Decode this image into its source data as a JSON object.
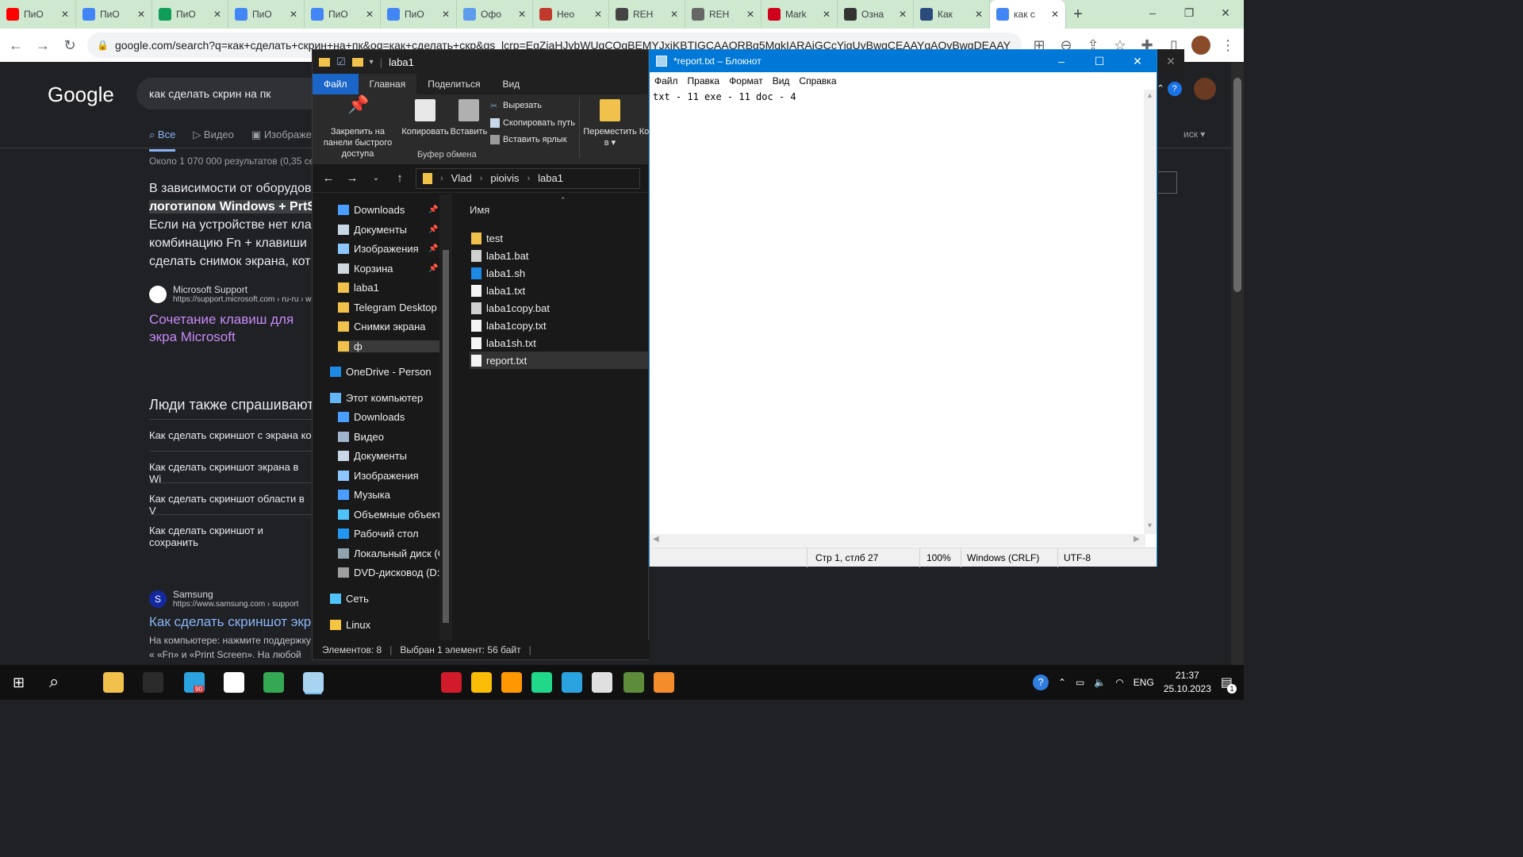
{
  "chrome": {
    "tabs": [
      {
        "label": "ПиО",
        "color": "#ff0000",
        "icon": "youtube-icon"
      },
      {
        "label": "ПиО",
        "color": "#4285f4",
        "icon": "docs-icon"
      },
      {
        "label": "ПиО",
        "color": "#0f9d58",
        "icon": "sheets-icon"
      },
      {
        "label": "ПиО",
        "color": "#4285f4",
        "icon": "docs-icon"
      },
      {
        "label": "ПиО",
        "color": "#4285f4",
        "icon": "docs-icon"
      },
      {
        "label": "ПиО",
        "color": "#4285f4",
        "icon": "docs-icon"
      },
      {
        "label": "Офо",
        "color": "#5d9cec",
        "icon": "settings-icon"
      },
      {
        "label": "Нео",
        "color": "#c0392b",
        "icon": "doc-red-icon"
      },
      {
        "label": "REH",
        "color": "#444444",
        "icon": "github-icon"
      },
      {
        "label": "REH",
        "color": "#666666",
        "icon": "github-icon"
      },
      {
        "label": "Mark",
        "color": "#d0021b",
        "icon": "vivaldi-icon"
      },
      {
        "label": "Озна",
        "color": "#333333",
        "icon": "keyboard-icon"
      },
      {
        "label": "Как",
        "color": "#2b4b7c",
        "icon": "app-icon"
      },
      {
        "label": "как с",
        "color": "#4285f4",
        "icon": "google-icon"
      }
    ],
    "new_tab": "+",
    "url": "google.com/search?q=как+сделать+скрин+на+пк&oq=как+сделать+скр&gs_lcrp=EgZjaHJvbWUqCQgBEMYJxjKBTIGCAAQRBg5MgkIARAjGCcYigUyBwgCEAAYgAQyBwgDEAAY",
    "window_controls": {
      "minimize": "–",
      "restore": "❐",
      "close": "✕"
    }
  },
  "google": {
    "logo": "Google",
    "query": "как сделать скрин на пк",
    "tabs": [
      "Все",
      "Видео",
      "Изображен"
    ],
    "active_tab": "Все",
    "tools": "иск ▾",
    "results_count": "Около 1 070 000 результатов (0,35 сек",
    "snippet_before": "В зависимости от оборудов",
    "snippet_highlight": "логотипом Windows + PrtSc",
    "snippet_after": "Если на устройстве нет кла комбинацию Fn + клавиши сделать снимок экрана, кот",
    "source1_name": "Microsoft Support",
    "source1_url": "https://support.microsoft.com › ru-ru › w",
    "link1": "Сочетание клавиш для экра Microsoft",
    "people_title": "Люди также спрашивают",
    "questions": [
      "Как сделать скриншот с экрана ко",
      "Как сделать скриншот экрана в Wi",
      "Как сделать скриншот области в V",
      "Как сделать скриншот и сохранить"
    ],
    "source2_letter": "S",
    "source2_name": "Samsung",
    "source2_url": "https://www.samsung.com › support",
    "link2": "Как сделать скриншот экра",
    "desc2": "На компьютере: нажмите поддержку « «Fn» и «Print Screen». На любой клави"
  },
  "explorer": {
    "title": "laba1",
    "ribbon_tabs": [
      "Файл",
      "Главная",
      "Поделиться",
      "Вид"
    ],
    "ribbon": {
      "pin": "Закрепить на панели быстрого доступа",
      "copy": "Копировать",
      "paste": "Вставить",
      "cut": "Вырезать",
      "copy_path": "Скопировать путь",
      "paste_shortcut": "Вставить ярлык",
      "move": "Переместить в ▾",
      "move_tail": "Ко",
      "group_label": "Буфер обмена"
    },
    "path": [
      "Vlad",
      "pioivis",
      "laba1"
    ],
    "nav_items": [
      {
        "label": "Downloads",
        "icon": "download-icon",
        "color": "#4a9eff",
        "pinned": true
      },
      {
        "label": "Документы",
        "icon": "documents-icon",
        "color": "#c8d6e5",
        "pinned": true
      },
      {
        "label": "Изображения",
        "icon": "pictures-icon",
        "color": "#8ec5ff",
        "pinned": true
      },
      {
        "label": "Корзина",
        "icon": "recycle-bin-icon",
        "color": "#cfd8dc",
        "pinned": true
      },
      {
        "label": "laba1",
        "icon": "folder-icon",
        "color": "#f0c14b",
        "pinned": false
      },
      {
        "label": "Telegram Desktop",
        "icon": "folder-icon",
        "color": "#f0c14b",
        "pinned": false
      },
      {
        "label": "Снимки экрана",
        "icon": "folder-icon",
        "color": "#f0c14b",
        "pinned": false
      },
      {
        "label": "ф",
        "icon": "folder-icon",
        "color": "#f0c14b",
        "pinned": false
      }
    ],
    "onedrive": "OneDrive - Personal",
    "thispc": "Этот компьютер",
    "pc_items": [
      {
        "label": "Downloads",
        "icon": "download-icon",
        "color": "#4a9eff"
      },
      {
        "label": "Видео",
        "icon": "video-icon",
        "color": "#a0b4d0"
      },
      {
        "label": "Документы",
        "icon": "documents-icon",
        "color": "#c8d6e5"
      },
      {
        "label": "Изображения",
        "icon": "pictures-icon",
        "color": "#8ec5ff"
      },
      {
        "label": "Музыка",
        "icon": "music-icon",
        "color": "#4a9eff"
      },
      {
        "label": "Объемные объекты",
        "icon": "3d-objects-icon",
        "color": "#4fc3f7"
      },
      {
        "label": "Рабочий стол",
        "icon": "desktop-icon",
        "color": "#2196f3"
      },
      {
        "label": "Локальный диск (C",
        "icon": "disk-icon",
        "color": "#90a4ae"
      },
      {
        "label": "DVD-дисковод (D:)",
        "icon": "dvd-icon",
        "color": "#9e9e9e"
      }
    ],
    "network": "Сеть",
    "linux": "Linux",
    "column_header": "Имя",
    "files": [
      {
        "name": "test",
        "icon": "folder-icon",
        "color": "#f0c14b"
      },
      {
        "name": "laba1.bat",
        "icon": "bat-file-icon",
        "color": "#d0d0d0"
      },
      {
        "name": "laba1.sh",
        "icon": "ie-file-icon",
        "color": "#1e88e5"
      },
      {
        "name": "laba1.txt",
        "icon": "text-file-icon",
        "color": "#f5f5f5"
      },
      {
        "name": "laba1copy.bat",
        "icon": "bat-file-icon",
        "color": "#d0d0d0"
      },
      {
        "name": "laba1copy.txt",
        "icon": "text-file-icon",
        "color": "#f5f5f5"
      },
      {
        "name": "laba1sh.txt",
        "icon": "text-file-icon",
        "color": "#f5f5f5"
      },
      {
        "name": "report.txt",
        "icon": "text-file-icon",
        "color": "#f5f5f5",
        "selected": true
      }
    ],
    "status_count": "Элементов: 8",
    "status_selected": "Выбран 1 элемент: 56 байт"
  },
  "notepad": {
    "title": "*report.txt – Блокнот",
    "menu": [
      "Файл",
      "Правка",
      "Формат",
      "Вид",
      "Справка"
    ],
    "content": "txt - 11 exe - 11 doc - 4",
    "status_pos": "Стр 1, стлб 27",
    "status_zoom": "100%",
    "status_eol": "Windows (CRLF)",
    "status_enc": "UTF-8"
  },
  "taskbar": {
    "telegram_badge": "90",
    "lang": "ENG",
    "time": "21:37",
    "date": "25.10.2023",
    "notif_count": "1"
  }
}
